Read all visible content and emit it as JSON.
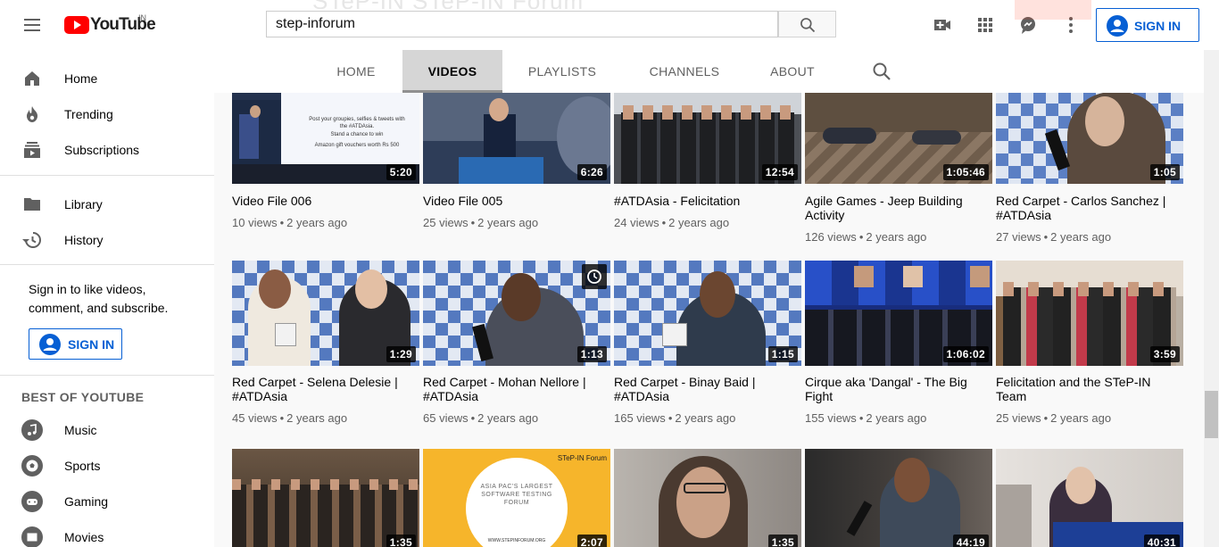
{
  "header": {
    "logo_text": "YouTube",
    "region": "IN",
    "search_value": "step-inforum",
    "signin_label": "SIGN IN",
    "banner_ghost_text": "STeP-IN   STeP-IN Forum"
  },
  "tabs": [
    {
      "label": "HOME"
    },
    {
      "label": "VIDEOS"
    },
    {
      "label": "PLAYLISTS"
    },
    {
      "label": "CHANNELS"
    },
    {
      "label": "ABOUT"
    }
  ],
  "sidebar": {
    "items": [
      {
        "label": "Home",
        "icon": "home-icon"
      },
      {
        "label": "Trending",
        "icon": "flame-icon"
      },
      {
        "label": "Subscriptions",
        "icon": "subscriptions-icon"
      },
      {
        "label": "Library",
        "icon": "folder-icon"
      },
      {
        "label": "History",
        "icon": "history-icon"
      }
    ],
    "signin_prompt": "Sign in to like videos, comment, and subscribe.",
    "signin_label": "SIGN IN",
    "section_title": "BEST OF YOUTUBE",
    "best_items": [
      {
        "label": "Music",
        "icon": "music-icon"
      },
      {
        "label": "Sports",
        "icon": "sports-icon"
      },
      {
        "label": "Gaming",
        "icon": "gaming-icon"
      },
      {
        "label": "Movies",
        "icon": "movies-icon"
      }
    ]
  },
  "videos": [
    {
      "title": "Video File 006",
      "duration": "5:20",
      "views": "10 views",
      "age": "2 years ago",
      "theme": "#2a3550"
    },
    {
      "title": "Video File 005",
      "duration": "6:26",
      "views": "25 views",
      "age": "2 years ago",
      "theme": "#24344a"
    },
    {
      "title": "#ATDAsia - Felicitation",
      "duration": "12:54",
      "views": "24 views",
      "age": "2 years ago",
      "theme": "#3a3a3a"
    },
    {
      "title": "Agile Games - Jeep Building Activity",
      "duration": "1:05:46",
      "views": "126 views",
      "age": "2 years ago",
      "theme": "#6b5a48"
    },
    {
      "title": "Red Carpet - Carlos Sanchez | #ATDAsia",
      "duration": "1:05",
      "views": "27 views",
      "age": "2 years ago",
      "theme": "#8fa3c0"
    },
    {
      "title": "Red Carpet - Selena Delesie | #ATDAsia",
      "duration": "1:29",
      "views": "45 views",
      "age": "2 years ago",
      "theme": "#7f95b8"
    },
    {
      "title": "Red Carpet - Mohan Nellore | #ATDAsia",
      "duration": "1:13",
      "views": "65 views",
      "age": "2 years ago",
      "theme": "#8a9dbc"
    },
    {
      "title": "Red Carpet - Binay Baid | #ATDAsia",
      "duration": "1:15",
      "views": "165 views",
      "age": "2 years ago",
      "theme": "#7d90b0"
    },
    {
      "title": "Cirque aka 'Dangal' - The Big Fight",
      "duration": "1:06:02",
      "views": "155 views",
      "age": "2 years ago",
      "theme": "#1b2e6b"
    },
    {
      "title": "Felicitation and the STeP-IN Team",
      "duration": "3:59",
      "views": "25 views",
      "age": "2 years ago",
      "theme": "#8a6a4a"
    },
    {
      "title": "",
      "duration": "1:35",
      "views": "",
      "age": "",
      "theme": "#5a4838"
    },
    {
      "title": "",
      "duration": "2:07",
      "views": "",
      "age": "",
      "theme": "#f5b42a"
    },
    {
      "title": "",
      "duration": "1:35",
      "views": "",
      "age": "",
      "theme": "#7a7470"
    },
    {
      "title": "",
      "duration": "44:19",
      "views": "",
      "age": "",
      "theme": "#3f3a36"
    },
    {
      "title": "",
      "duration": "40:31",
      "views": "",
      "age": "",
      "theme": "#c9c4c0"
    }
  ],
  "thumb_text": {
    "atd_post": "Post your groupies, selfies & tweets with the #ATDAsia.",
    "atd_chance": "Stand a chance to win",
    "atd_prize": "Amazon gift vouchers worth Rs 500",
    "forum_banner": "ASIA PAC'S LARGEST SOFTWARE TESTING FORUM",
    "forum_brand": "STeP-IN Forum",
    "forum_url": "WWW.STEPINFORUM.ORG"
  },
  "colors": {
    "accent": "#065fd4",
    "brand_red": "#ff0000",
    "tab_active_bg": "#d6d6d6"
  }
}
